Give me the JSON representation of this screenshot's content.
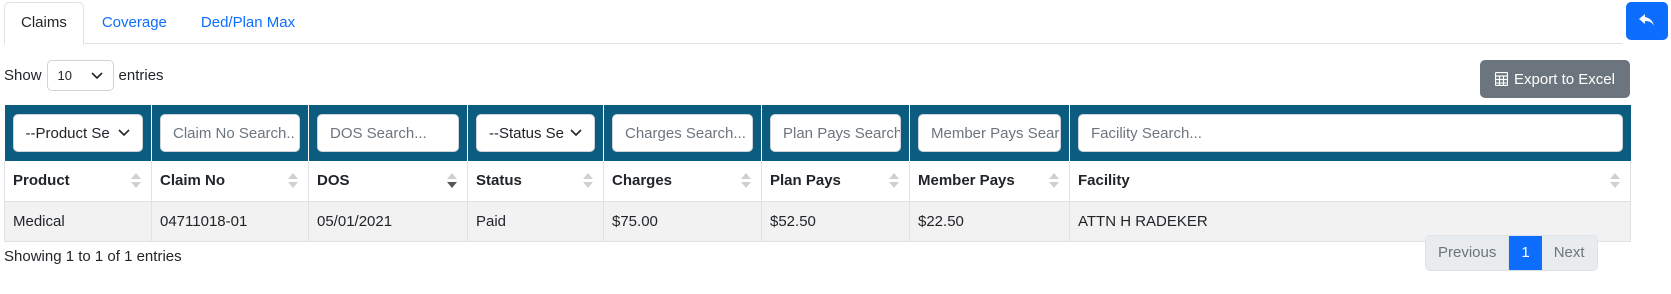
{
  "tabs": [
    {
      "label": "Claims",
      "active": true
    },
    {
      "label": "Coverage",
      "active": false
    },
    {
      "label": "Ded/Plan Max",
      "active": false
    }
  ],
  "toolbar": {
    "show_label": "Show",
    "entries_value": "10",
    "entries_label": "entries",
    "export_label": "Export to Excel"
  },
  "filters": {
    "product": "--Product Se",
    "claim_no": "Claim No Search..",
    "dos": "DOS Search...",
    "status": "--Status Se",
    "charges": "Charges Search...",
    "plan_pays": "Plan Pays Search",
    "member_pays": "Member Pays Sear",
    "facility": "Facility Search..."
  },
  "columns": [
    "Product",
    "Claim No",
    "DOS",
    "Status",
    "Charges",
    "Plan Pays",
    "Member Pays",
    "Facility"
  ],
  "rows": [
    [
      "Medical",
      "04711018-01",
      "05/01/2021",
      "Paid",
      "$75.00",
      "$52.50",
      "$22.50",
      "ATTN H RADEKER"
    ]
  ],
  "footer": {
    "info": "Showing 1 to 1 of 1 entries",
    "previous": "Previous",
    "page": "1",
    "next": "Next"
  },
  "colors": {
    "filter_bar": "#0b5c7f",
    "primary": "#0d6efd",
    "export": "#6c757d"
  },
  "icons": [
    "reply-arrow-icon",
    "chevron-down-icon",
    "table-icon",
    "sort-icon"
  ]
}
